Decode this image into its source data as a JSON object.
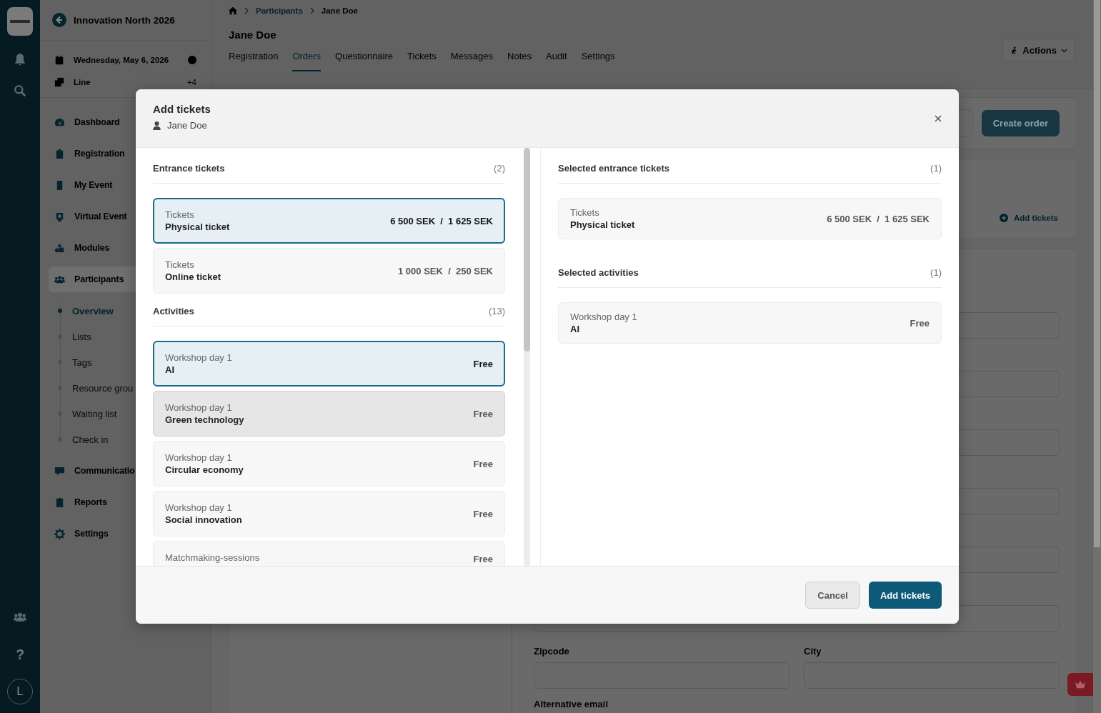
{
  "rail": {
    "help": "?",
    "avatar": "L"
  },
  "event": {
    "title": "Innovation North 2026",
    "date": "Wednesday, May 6, 2026",
    "line": "Line",
    "line_count": "+4"
  },
  "nav": [
    {
      "label": "Dashboard",
      "selected": false
    },
    {
      "label": "Registration",
      "selected": false
    },
    {
      "label": "My Event",
      "selected": false
    },
    {
      "label": "Virtual Event",
      "selected": false
    },
    {
      "label": "Modules",
      "selected": false
    },
    {
      "label": "Participants",
      "selected": true,
      "children": [
        {
          "label": "Overview",
          "selected": true
        },
        {
          "label": "Lists",
          "selected": false
        },
        {
          "label": "Tags",
          "selected": false
        },
        {
          "label": "Resource grou",
          "selected": false
        },
        {
          "label": "Waiting list",
          "selected": false
        },
        {
          "label": "Check in",
          "selected": false
        }
      ]
    },
    {
      "label": "Communicatio",
      "selected": false
    },
    {
      "label": "Reports",
      "selected": false
    },
    {
      "label": "Settings",
      "selected": false
    }
  ],
  "breadcrumb": [
    "Participants",
    "Jane Doe"
  ],
  "page": {
    "title": "Jane Doe",
    "actions": "Actions",
    "create_order": "Create order",
    "add_tickets": "Add tickets",
    "field_labels": [
      "Zipcode",
      "City"
    ],
    "last_label": "Alternative email"
  },
  "tabs": [
    {
      "label": "Registration",
      "selected": false
    },
    {
      "label": "Orders",
      "selected": true
    },
    {
      "label": "Questionnaire",
      "selected": false
    },
    {
      "label": "Tickets",
      "selected": false
    },
    {
      "label": "Messages",
      "selected": false
    },
    {
      "label": "Notes",
      "selected": false
    },
    {
      "label": "Audit",
      "selected": false
    },
    {
      "label": "Settings",
      "selected": false
    }
  ],
  "modal": {
    "title": "Add tickets",
    "participant": "Jane Doe",
    "sections": [
      {
        "title": "Entrance tickets",
        "count": "(2)",
        "items": [
          {
            "category": "Tickets",
            "name": "Physical ticket",
            "price": "6 500 SEK  /  1 625 SEK",
            "selected": true,
            "hovered": false
          },
          {
            "category": "Tickets",
            "name": "Online ticket",
            "price": "1 000 SEK  /  250 SEK",
            "selected": false,
            "hovered": false
          }
        ]
      },
      {
        "title": "Activities",
        "count": "(13)",
        "items": [
          {
            "category": "Workshop day 1",
            "name": "AI",
            "price": "Free",
            "selected": true,
            "hovered": false
          },
          {
            "category": "Workshop day 1",
            "name": "Green technology",
            "price": "Free",
            "selected": false,
            "hovered": true
          },
          {
            "category": "Workshop day 1",
            "name": "Circular economy",
            "price": "Free",
            "selected": false,
            "hovered": false
          },
          {
            "category": "Workshop day 1",
            "name": "Social innovation",
            "price": "Free",
            "selected": false,
            "hovered": false
          },
          {
            "category": "Matchmaking-sessions",
            "price": "Free",
            "selected": false,
            "hovered": false
          }
        ]
      }
    ],
    "selected_sections": [
      {
        "title": "Selected entrance tickets",
        "count": "(1)",
        "items": [
          {
            "category": "Tickets",
            "name": "Physical ticket",
            "price": "6 500 SEK  /  1 625 SEK"
          }
        ]
      },
      {
        "title": "Selected activities",
        "count": "(1)",
        "items": [
          {
            "category": "Workshop day 1",
            "name": "AI",
            "price": "Free"
          }
        ]
      }
    ],
    "cancel": "Cancel",
    "confirm": "Add tickets"
  }
}
